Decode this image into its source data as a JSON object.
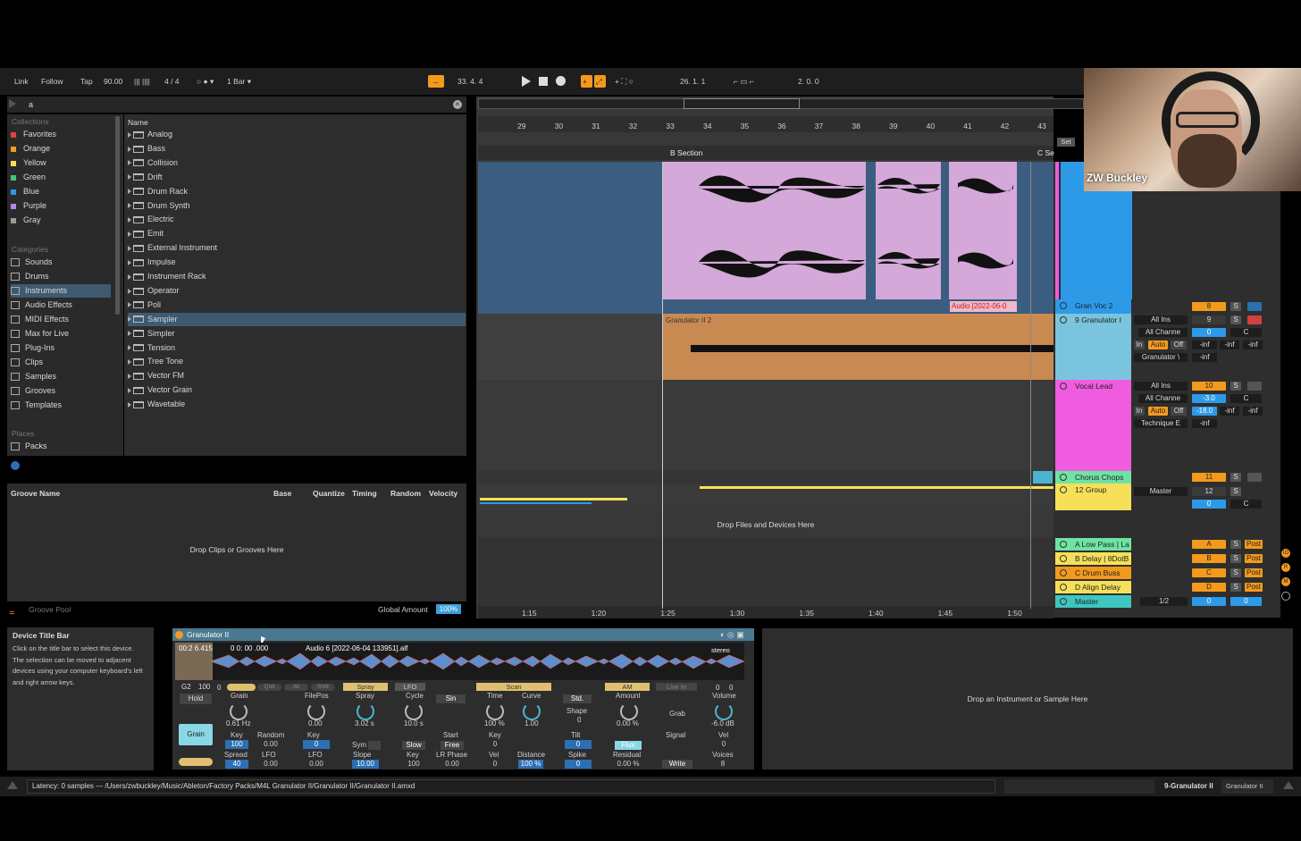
{
  "colors": {
    "accent": "#f39a1d",
    "teal": "#4bb4d0",
    "pink": "#f05ce0",
    "blue": "#2d9ae8",
    "sky": "#7ac5dd",
    "yellow": "#f6e05a",
    "green": "#6fe3a3",
    "clip_purple": "#d4a8d9",
    "clip_orange": "#c98a52"
  },
  "transport": {
    "link": "Link",
    "follow": "Follow",
    "tap": "Tap",
    "tempo": "90.00",
    "signature": "4 / 4",
    "quantize": "1 Bar",
    "position": "33.  4.  4",
    "loop_start": "26.  1.  1",
    "loop_length": "2.  0.  0"
  },
  "browser": {
    "search_value": "a",
    "collections_header": "Collections",
    "collections": [
      {
        "label": "Favorites",
        "color": "#e0443c"
      },
      {
        "label": "Orange",
        "color": "#f39a1d"
      },
      {
        "label": "Yellow",
        "color": "#f6e05a"
      },
      {
        "label": "Green",
        "color": "#3fc77a"
      },
      {
        "label": "Blue",
        "color": "#2d9ae8"
      },
      {
        "label": "Purple",
        "color": "#b08ae8"
      },
      {
        "label": "Gray",
        "color": "#9a9a9a"
      }
    ],
    "categories_header": "Categories",
    "categories": [
      {
        "label": "Sounds",
        "icon": "note-icon"
      },
      {
        "label": "Drums",
        "icon": "grid-icon"
      },
      {
        "label": "Instruments",
        "icon": "instrument-icon"
      },
      {
        "label": "Audio Effects",
        "icon": "audio-fx-icon"
      },
      {
        "label": "MIDI Effects",
        "icon": "midi-fx-icon"
      },
      {
        "label": "Max for Live",
        "icon": "max-icon"
      },
      {
        "label": "Plug-Ins",
        "icon": "plugin-icon"
      },
      {
        "label": "Clips",
        "icon": "clip-icon"
      },
      {
        "label": "Samples",
        "icon": "wave-icon"
      },
      {
        "label": "Grooves",
        "icon": "groove-icon"
      },
      {
        "label": "Templates",
        "icon": "template-icon"
      }
    ],
    "places_header": "Places",
    "places": [
      {
        "label": "Packs",
        "icon": "pack-icon"
      }
    ],
    "name_header": "Name",
    "items": [
      "Analog",
      "Bass",
      "Collision",
      "Drift",
      "Drum Rack",
      "Drum Synth",
      "Electric",
      "Emit",
      "External Instrument",
      "Impulse",
      "Instrument Rack",
      "Operator",
      "Poli",
      "Sampler",
      "Simpler",
      "Tension",
      "Tree Tone",
      "Vector FM",
      "Vector Grain",
      "Wavetable"
    ],
    "selected_item": "Sampler"
  },
  "groove": {
    "headers": [
      "Groove Name",
      "Base",
      "Quantize",
      "Timing",
      "Random",
      "Velocity"
    ],
    "drop_text": "Drop Clips or Grooves Here",
    "pool_label": "Groove Pool",
    "global_amount_label": "Global Amount",
    "global_amount_value": "100%"
  },
  "arrangement": {
    "ruler": [
      "29",
      "30",
      "31",
      "32",
      "33",
      "34",
      "35",
      "36",
      "37",
      "38",
      "39",
      "40",
      "41",
      "42",
      "43"
    ],
    "locators": {
      "b_section": "B Section",
      "c_section": "C Se",
      "set_button": "Set"
    },
    "clip_audio": "Audio [2022-06-0",
    "clip_granulator": "Granulator II 2",
    "drop_files": "Drop Files and Devices Here",
    "times": [
      "1:15",
      "1:20",
      "1:25",
      "1:30",
      "1:35",
      "1:40",
      "1:45",
      "1:50"
    ]
  },
  "tracks": [
    {
      "name": "Gran Voc 2",
      "color": "#2d9ae8",
      "vol": "8",
      "pan": ""
    },
    {
      "name": "9 Granulator I",
      "color": "#7ac5dd",
      "input": "All Ins",
      "channel": "All Channe",
      "device": "Granulator \\",
      "vol": "9",
      "pan": "C",
      "num": "0",
      "inf1": "-inf",
      "inf2": "-inf",
      "inf3": "-inf",
      "inf4": "-inf"
    },
    {
      "name": "Vocal Lead",
      "color": "#f05ce0",
      "input": "All Ins",
      "channel": "All Channe",
      "device": "Technique E",
      "vol": "10",
      "vol_db": "-3.0",
      "pan": "C",
      "send_db": "-18.0",
      "inf1": "-inf",
      "inf2": "-inf",
      "inf3": "-inf"
    },
    {
      "name": "Chorus Chops",
      "color": "#6fe3a3",
      "vol": "11"
    },
    {
      "name": "12 Group",
      "color": "#f6e05a",
      "output": "Master",
      "vol": "12",
      "num": "0",
      "pan": "C"
    }
  ],
  "returns": [
    {
      "name": "A Low Pass | La",
      "letter": "A",
      "color": "#6fe3a3"
    },
    {
      "name": "B Delay | 8DotB",
      "letter": "B",
      "color": "#f6e05a"
    },
    {
      "name": "C Drum Buss",
      "letter": "C",
      "color": "#f39a1d"
    },
    {
      "name": "D Align Delay",
      "letter": "D",
      "color": "#f6e05a"
    }
  ],
  "master": {
    "name": "Master",
    "cue": "1/2",
    "num1": "0",
    "num2": "0"
  },
  "mix_labels": {
    "solo": "S",
    "post": "Post",
    "in": "In",
    "auto": "Auto",
    "off": "Off"
  },
  "overlay": {
    "person_name": "ZW Buckley"
  },
  "info": {
    "title": "Device Title Bar",
    "body": "Click on the title bar to select this device. The selection can be moved to adjacent devices using your computer keyboard's left and right arrow keys."
  },
  "device": {
    "title": "Granulator II",
    "time_a": "00:2 6.415",
    "time_b": "0 0: 00 .000",
    "sample": "Audio 6 [2022-06-04 133951].alf",
    "stereo": "stereo",
    "note": "G2",
    "velo": "100",
    "zero": "0",
    "tabs": [
      "Spray",
      "LFO",
      "Scan",
      "AM",
      "Live In"
    ],
    "tab_small": [
      "Quit",
      "Alt",
      "Shift"
    ],
    "controls": {
      "hold": "Hold",
      "grain_mode": "Grain",
      "grain_label": "Grain",
      "grain_val": "0.61 Hz",
      "filepos_label": "FilePos",
      "filepos_val": "0.00",
      "spray_label": "Spray",
      "spray_val": "3.02 s",
      "cycle_label": "Cycle",
      "cycle_val": "10.0 s",
      "cycle_wave": "Sin",
      "time_label": "Time",
      "time_val": "100 %",
      "curve_label": "Curve",
      "curve_val": "1.00",
      "std_label": "Std.",
      "shape_label": "Shape",
      "shape_val": "0",
      "amount_label": "Amount",
      "amount_val": "0.00 %",
      "grab_label": "Grab",
      "volume_label": "Volume",
      "volume_val": "-6.0 dB",
      "key_label": "Key",
      "key_val": "100",
      "random_label": "Random",
      "random_val": "0.00",
      "key2_label": "Key",
      "key2_val": "0",
      "sym_label": "Sym",
      "slope_label": "Slope",
      "slope_val": "10.00",
      "slow_label": "Slow",
      "free_label": "Free",
      "start_label": "Start",
      "lrphase_label": "LR Phase",
      "lrphase_val": "0.00",
      "key3_label": "Key",
      "key3_val": "0",
      "tilt_label": "Tilt",
      "tilt_val": "0",
      "flux_label": "Flux",
      "signal_label": "Signal",
      "vel_label": "Vel",
      "vel_val": "0",
      "spread_label": "Spread",
      "spread_val": "40",
      "lfo_label": "LFO",
      "lfo_val": "0.00",
      "lfo2_label": "LFO",
      "lfo2_val": "0.00",
      "key4_label": "Key",
      "key4_val": "100",
      "vel2_label": "Vel",
      "vel2_val": "0",
      "distance_label": "Distance",
      "distance_val": "100 %",
      "spike_label": "Spike",
      "spike_val": "0",
      "residual_label": "Residual",
      "residual_val": "0.00 %",
      "write_label": "Write",
      "voices_label": "Voices",
      "voices_val": "8",
      "out_l": "0",
      "out_r": "0"
    }
  },
  "drop_instrument": "Drop an Instrument or Sample Here",
  "status": {
    "latency": "Latency: 0 samples --- /Users/zwbuckley/Music/Ableton/Factory Packs/M4L Granulator II/Granulator II/Granulator II.amxd",
    "track": "9-Granulator II",
    "device": "Granulator II"
  }
}
